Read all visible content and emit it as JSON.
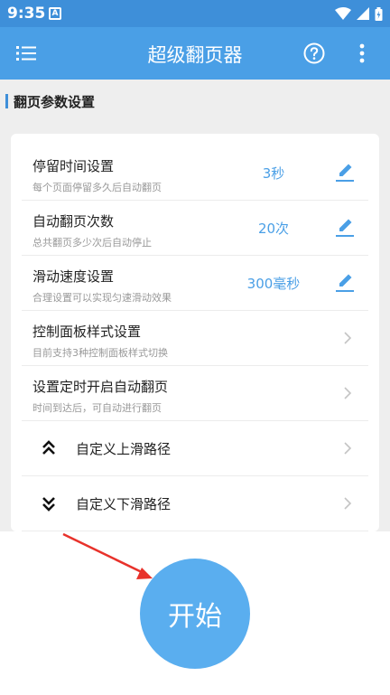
{
  "status": {
    "time": "9:35",
    "app_badge": "A"
  },
  "appbar": {
    "title": "超级翻页器"
  },
  "section": {
    "title": "翻页参数设置"
  },
  "settings": [
    {
      "title": "停留时间设置",
      "subtitle": "每个页面停留多久后自动翻页",
      "value": "3秒"
    },
    {
      "title": "自动翻页次数",
      "subtitle": "总共翻页多少次后自动停止",
      "value": "20次"
    },
    {
      "title": "滑动速度设置",
      "subtitle": "合理设置可以实现匀速滑动效果",
      "value": "300毫秒"
    },
    {
      "title": "控制面板样式设置",
      "subtitle": "目前支持3种控制面板样式切换"
    },
    {
      "title": "设置定时开启自动翻页",
      "subtitle": "时间到达后，可自动进行翻页"
    }
  ],
  "paths": [
    {
      "title": "自定义上滑路径",
      "icon": "double-chevron-up-icon"
    },
    {
      "title": "自定义下滑路径",
      "icon": "double-chevron-down-icon"
    }
  ],
  "start_button": {
    "label": "开始"
  },
  "colors": {
    "primary": "#4a9fe6",
    "status_bar": "#3e8fd9",
    "start_button": "#5aaeef",
    "annotation_arrow": "#e8322b"
  }
}
